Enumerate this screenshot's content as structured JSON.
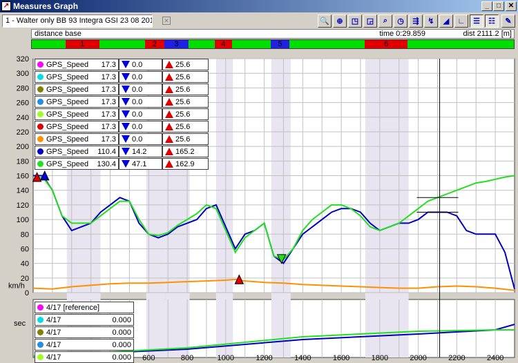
{
  "window": {
    "title": "Measures Graph"
  },
  "session": {
    "label": "1 - Walter only BB 93 Integra GSI 23 08 201"
  },
  "infobar": {
    "base": "distance base",
    "time": "time 0:29.859",
    "dist": "dist 2111.2 [m]"
  },
  "laps": [
    {
      "label": "1",
      "start": 0.07,
      "end": 0.14,
      "color": "#e00000"
    },
    {
      "label": "2",
      "start": 0.235,
      "end": 0.275,
      "color": "#e00000"
    },
    {
      "label": "3",
      "start": 0.275,
      "end": 0.325,
      "color": "#2020e0"
    },
    {
      "label": "4",
      "start": 0.38,
      "end": 0.415,
      "color": "#e00000"
    },
    {
      "label": "5",
      "start": 0.495,
      "end": 0.535,
      "color": "#2020e0"
    },
    {
      "label": "6",
      "start": 0.69,
      "end": 0.78,
      "color": "#e00000"
    }
  ],
  "legend": [
    {
      "color": "#ff00ff",
      "name": "GPS_Speed",
      "value": "17.3",
      "min": "0.0",
      "max": "25.6"
    },
    {
      "color": "#00e0e0",
      "name": "GPS_Speed",
      "value": "17.3",
      "min": "0.0",
      "max": "25.6"
    },
    {
      "color": "#808000",
      "name": "GPS_Speed",
      "value": "17.3",
      "min": "0.0",
      "max": "25.6"
    },
    {
      "color": "#2090e0",
      "name": "GPS_Speed",
      "value": "17.3",
      "min": "0.0",
      "max": "25.6"
    },
    {
      "color": "#a0ff20",
      "name": "GPS_Speed",
      "value": "17.3",
      "min": "0.0",
      "max": "25.6"
    },
    {
      "color": "#e00000",
      "name": "GPS_Speed",
      "value": "17.3",
      "min": "0.0",
      "max": "25.6"
    },
    {
      "color": "#ff9000",
      "name": "GPS_Speed",
      "value": "17.3",
      "min": "0.0",
      "max": "25.6"
    },
    {
      "color": "#0000c0",
      "name": "GPS_Speed",
      "value": "110.4",
      "min": "14.2",
      "max": "165.2"
    },
    {
      "color": "#20e020",
      "name": "GPS_Speed",
      "value": "130.4",
      "min": "47.1",
      "max": "162.9"
    }
  ],
  "lap_list": [
    {
      "color": "#ff00ff",
      "name": "4/17 [reference]",
      "value": ""
    },
    {
      "color": "#00e0e0",
      "name": "4/17",
      "value": "0.000"
    },
    {
      "color": "#808000",
      "name": "4/17",
      "value": "0.000"
    },
    {
      "color": "#2090e0",
      "name": "4/17",
      "value": "0.000"
    },
    {
      "color": "#a0ff20",
      "name": "4/17",
      "value": "0.000"
    }
  ],
  "chart_data": {
    "type": "line",
    "xlabel": "",
    "ylabel": "km/h",
    "xlim": [
      0,
      2500
    ],
    "ylim": [
      0,
      320
    ],
    "y_ticks": [
      0,
      20,
      40,
      60,
      80,
      100,
      120,
      140,
      160,
      180,
      200,
      220,
      240,
      260,
      280,
      300,
      320
    ],
    "x_ticks": [
      600,
      800,
      1000,
      1200,
      1400,
      1600,
      1800,
      2000,
      2200,
      2400
    ],
    "cursor_x": 2111,
    "series": [
      {
        "color": "#0000c0",
        "x": [
          0,
          50,
          100,
          150,
          200,
          250,
          300,
          350,
          400,
          450,
          500,
          550,
          600,
          650,
          700,
          750,
          800,
          850,
          900,
          950,
          1000,
          1050,
          1100,
          1150,
          1200,
          1250,
          1300,
          1350,
          1400,
          1450,
          1500,
          1550,
          1600,
          1650,
          1700,
          1750,
          1800,
          1850,
          1900,
          1950,
          2000,
          2050,
          2100,
          2150,
          2200,
          2250,
          2300,
          2350,
          2400,
          2450,
          2500
        ],
        "y": [
          160,
          160,
          140,
          105,
          85,
          90,
          95,
          110,
          120,
          130,
          125,
          95,
          80,
          75,
          80,
          90,
          95,
          100,
          115,
          120,
          90,
          60,
          80,
          85,
          95,
          50,
          40,
          60,
          80,
          90,
          100,
          110,
          115,
          115,
          110,
          95,
          85,
          90,
          95,
          95,
          100,
          110,
          110,
          110,
          105,
          85,
          80,
          80,
          80,
          55,
          5
        ]
      },
      {
        "color": "#20e020",
        "x": [
          0,
          50,
          100,
          150,
          200,
          250,
          300,
          350,
          400,
          450,
          500,
          550,
          600,
          650,
          700,
          750,
          800,
          850,
          900,
          950,
          1000,
          1050,
          1100,
          1150,
          1200,
          1250,
          1300,
          1350,
          1400,
          1450,
          1500,
          1550,
          1600,
          1650,
          1700,
          1750,
          1800,
          1850,
          1900,
          1950,
          2000,
          2050,
          2100,
          2150,
          2200,
          2250,
          2300,
          2350,
          2400,
          2450,
          2500
        ],
        "y": [
          155,
          158,
          140,
          105,
          95,
          95,
          95,
          105,
          115,
          125,
          125,
          100,
          80,
          78,
          82,
          92,
          100,
          108,
          120,
          115,
          85,
          55,
          75,
          85,
          95,
          50,
          45,
          60,
          85,
          100,
          110,
          120,
          120,
          115,
          105,
          90,
          85,
          90,
          95,
          105,
          115,
          125,
          130,
          135,
          140,
          145,
          150,
          152,
          155,
          158,
          160
        ]
      },
      {
        "color": "#ff9000",
        "x": [
          0,
          100,
          200,
          300,
          400,
          500,
          600,
          700,
          800,
          900,
          1000,
          1050,
          1100,
          1200,
          1300,
          1400,
          1500,
          1600,
          1700,
          1800,
          1900,
          2000,
          2100,
          2200,
          2300,
          2400,
          2500
        ],
        "y": [
          6,
          5,
          8,
          10,
          12,
          13,
          13,
          14,
          15,
          16,
          17,
          18,
          16,
          14,
          13,
          11,
          10,
          9,
          8,
          7,
          6,
          6,
          8,
          9,
          8,
          6,
          3
        ]
      }
    ]
  }
}
